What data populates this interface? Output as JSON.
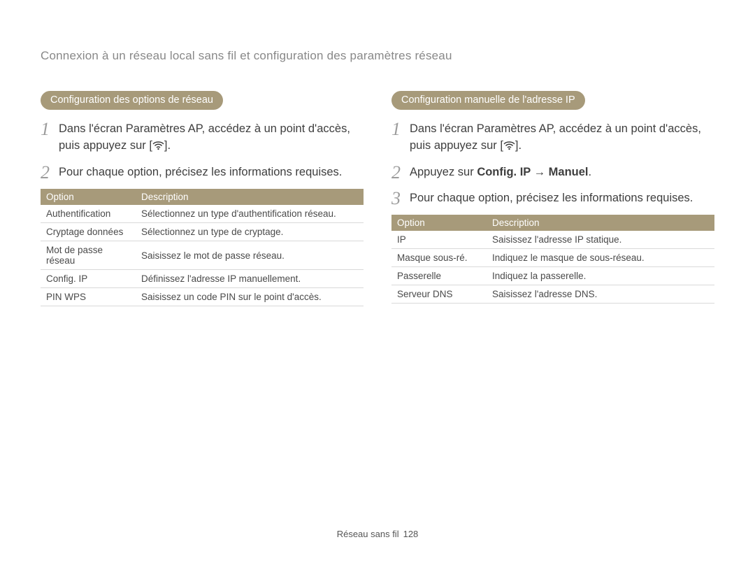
{
  "page_title": "Connexion à un réseau local sans fil et configuration des paramètres réseau",
  "wifi_icon_label": "wifi-icon",
  "left": {
    "heading": "Configuration des options de réseau",
    "steps": [
      {
        "num": "1",
        "prefix": "Dans l'écran Paramètres AP, accédez à un point d'accès, puis appuyez sur [",
        "has_icon": true,
        "suffix": "]."
      },
      {
        "num": "2",
        "prefix": "Pour chaque option, précisez les informations requises.",
        "has_icon": false,
        "suffix": ""
      }
    ],
    "table": {
      "headers": [
        "Option",
        "Description"
      ],
      "rows": [
        [
          "Authentification",
          "Sélectionnez un type d'authentification réseau."
        ],
        [
          "Cryptage données",
          "Sélectionnez un type de cryptage."
        ],
        [
          "Mot de passe réseau",
          "Saisissez le mot de passe réseau."
        ],
        [
          "Config. IP",
          "Définissez l'adresse IP manuellement."
        ],
        [
          "PIN WPS",
          "Saisissez un code PIN sur le point d'accès."
        ]
      ]
    }
  },
  "right": {
    "heading": "Configuration manuelle de l'adresse IP",
    "steps": [
      {
        "num": "1",
        "prefix": "Dans l'écran Paramètres AP, accédez à un point d'accès, puis appuyez sur [",
        "has_icon": true,
        "suffix": "]."
      },
      {
        "num": "2",
        "prefix": "Appuyez sur ",
        "bold": "Config. IP → Manuel",
        "suffix2": ".",
        "has_icon": false
      },
      {
        "num": "3",
        "prefix": "Pour chaque option, précisez les informations requises.",
        "has_icon": false,
        "suffix": ""
      }
    ],
    "table": {
      "headers": [
        "Option",
        "Description"
      ],
      "rows": [
        [
          "IP",
          "Saisissez l'adresse IP statique."
        ],
        [
          "Masque sous-ré.",
          "Indiquez le masque de sous-réseau."
        ],
        [
          "Passerelle",
          "Indiquez la passerelle."
        ],
        [
          "Serveur DNS",
          "Saisissez l'adresse DNS."
        ]
      ]
    }
  },
  "footer": {
    "section": "Réseau sans fil",
    "page": "128"
  }
}
